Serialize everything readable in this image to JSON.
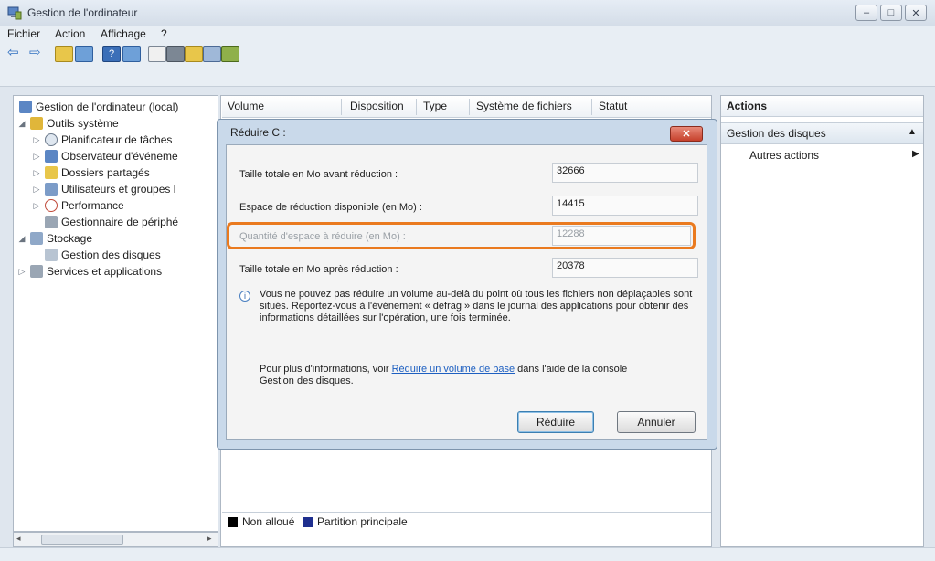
{
  "window": {
    "title": "Gestion de l'ordinateur",
    "controls": [
      "–",
      "□",
      "✕"
    ]
  },
  "menu": [
    "Fichier",
    "Action",
    "Affichage",
    "?"
  ],
  "tree": {
    "root": "Gestion de l'ordinateur (local)",
    "system_tools": "Outils système",
    "items": [
      "Planificateur de tâches",
      "Observateur d'événeme",
      "Dossiers partagés",
      "Utilisateurs et groupes l",
      "Performance",
      "Gestionnaire de périphé"
    ],
    "storage": "Stockage",
    "disk_mgmt": "Gestion des disques",
    "services": "Services et applications"
  },
  "columns": [
    "Volume",
    "Disposition",
    "Type",
    "Système de fichiers",
    "Statut"
  ],
  "dialog": {
    "title": "Réduire C :",
    "rows": [
      {
        "label": "Taille totale en Mo avant réduction :",
        "value": "32666"
      },
      {
        "label": "Espace de réduction disponible (en Mo) :",
        "value": "14415"
      },
      {
        "label": "Quantité d'espace à réduire (en Mo) :",
        "value": "12288"
      },
      {
        "label": "Taille totale en Mo après réduction :",
        "value": "20378"
      }
    ],
    "info_text": "Vous ne pouvez pas réduire un volume au-delà du point où tous les fichiers non déplaçables sont situés. Reportez-vous à l'événement « defrag » dans le journal des applications pour obtenir des informations détaillées sur l'opération, une fois terminée.",
    "more_info_prefix": "Pour plus d'informations, voir",
    "more_info_link": "Réduire un volume de base",
    "more_info_suffix": "dans l'aide de la console Gestion des disques.",
    "btn_reduce": "Réduire",
    "btn_cancel": "Annuler"
  },
  "legend": {
    "unallocated": "Non alloué",
    "primary": "Partition principale"
  },
  "actions": {
    "header": "Actions",
    "section": "Gestion des disques",
    "other": "Autres actions"
  },
  "colors": {
    "highlight": "#ea7a1f",
    "unallocated": "#000000",
    "primary": "#1f2f8f"
  }
}
